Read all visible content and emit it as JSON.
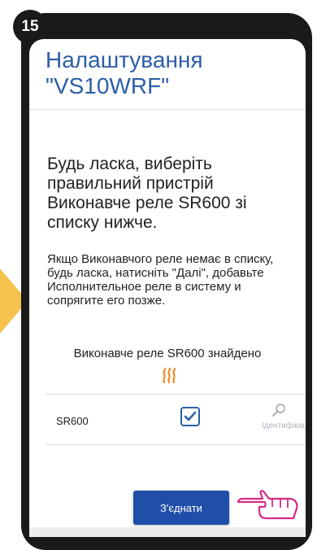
{
  "step": "15",
  "header": {
    "title": "Налаштування \"VS10WRF\""
  },
  "content": {
    "heading": "Будь ласка, виберіть правильний пристрій Виконавче реле SR600 зі списку нижче.",
    "info": "Якщо Виконавчого реле немає в списку, будь ласка, натисніть \"Далі\", добавьте Исполнительное реле в систему и сопрягите его позже.",
    "found_text": "Виконавче реле SR600 знайдено"
  },
  "device": {
    "name": "SR600",
    "selected": true,
    "identify_label": "Ідентифікація"
  },
  "connect_button": {
    "label": "З'єднати"
  },
  "colors": {
    "accent": "#2c5ea8",
    "button": "#1f4fa8",
    "heat_icon": "#f08a24",
    "hand_outline": "#d62a87",
    "arrow": "#f6c44e"
  }
}
